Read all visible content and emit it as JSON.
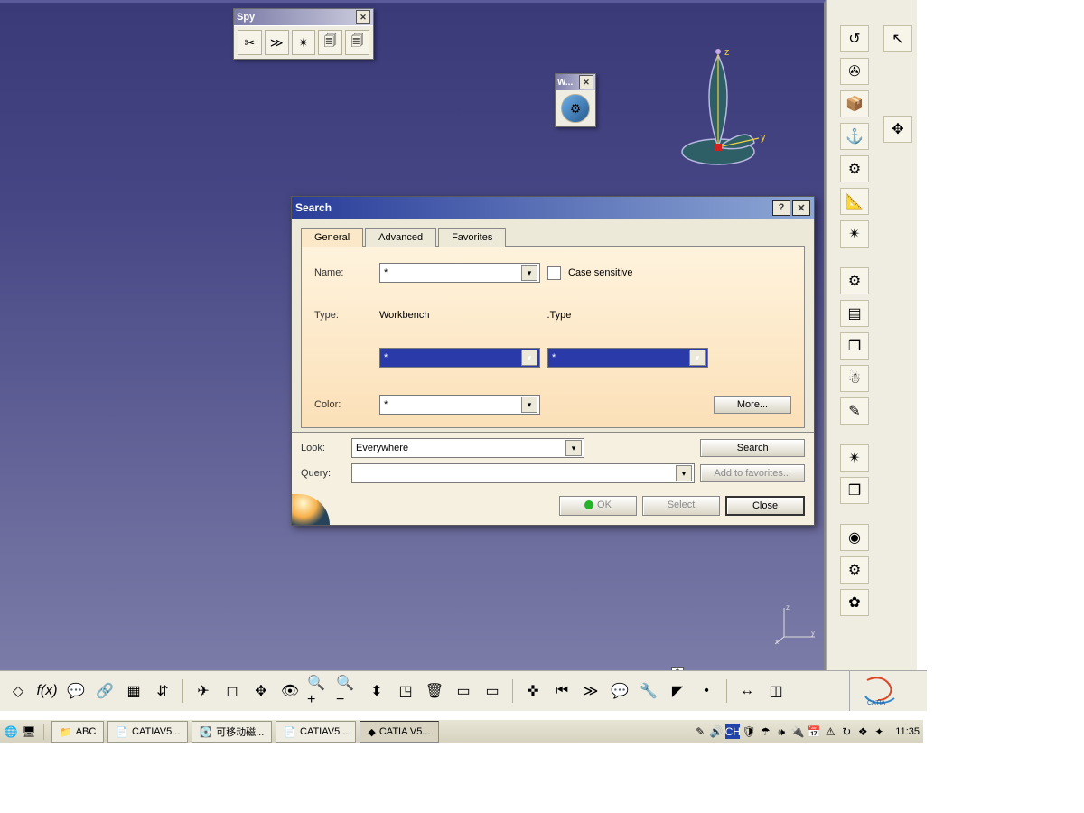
{
  "spy_toolbar": {
    "title": "Spy"
  },
  "mini_toolbar": {
    "title": "W..."
  },
  "axis": {
    "z": "z",
    "y": "y",
    "x": "x"
  },
  "search_dialog": {
    "title": "Search",
    "tabs": {
      "general": "General",
      "advanced": "Advanced",
      "favorites": "Favorites"
    },
    "name_label": "Name:",
    "name_value": "*",
    "case_sensitive_label": "Case sensitive",
    "type_label": "Type:",
    "workbench_label": "Workbench",
    "dot_type_label": ".Type",
    "workbench_value": "*",
    "type_value": "*",
    "color_label": "Color:",
    "color_value": "*",
    "more_btn": "More...",
    "look_label": "Look:",
    "look_value": "Everywhere",
    "query_label": "Query:",
    "query_value": "",
    "search_btn": "Search",
    "add_fav_btn": "Add to favorites...",
    "ok_btn": "OK",
    "select_btn": "Select",
    "close_btn": "Close",
    "starbox": "*"
  },
  "taskbar": {
    "abc": "ABC",
    "doc1": "CATIAV5...",
    "disk": "可移动磁...",
    "doc2": "CATIAV5...",
    "catia": "CATIA V5...",
    "clock": "11:35"
  },
  "logo": {
    "text": "CATIA"
  }
}
